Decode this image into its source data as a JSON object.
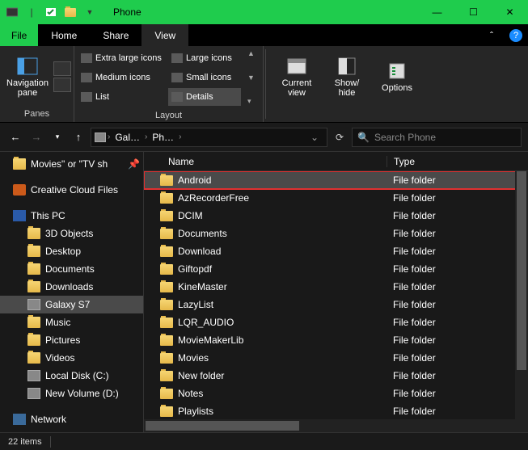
{
  "title": "Phone",
  "menu": {
    "file": "File",
    "tabs": [
      "Home",
      "Share",
      "View"
    ],
    "active": 2
  },
  "ribbon": {
    "panes": {
      "nav_label": "Navigation\npane",
      "group": "Panes"
    },
    "layout": {
      "items": [
        "Extra large icons",
        "Large icons",
        "Medium icons",
        "Small icons",
        "List",
        "Details"
      ],
      "selected": "Details",
      "group": "Layout"
    },
    "current_view": "Current\nview",
    "show_hide": "Show/\nhide",
    "options": "Options"
  },
  "addr": {
    "crumbs": [
      "Gal…",
      "Ph…"
    ],
    "search_placeholder": "Search Phone"
  },
  "tree": [
    {
      "label": "Movies\" or \"TV sh",
      "icon": "folder",
      "pin": true
    },
    {
      "spacer": true
    },
    {
      "label": "Creative Cloud Files",
      "icon": "cloud"
    },
    {
      "spacer": true
    },
    {
      "label": "This PC",
      "icon": "pc"
    },
    {
      "label": "3D Objects",
      "icon": "folder",
      "lvl": 2
    },
    {
      "label": "Desktop",
      "icon": "folder",
      "lvl": 2
    },
    {
      "label": "Documents",
      "icon": "folder",
      "lvl": 2
    },
    {
      "label": "Downloads",
      "icon": "folder",
      "lvl": 2
    },
    {
      "label": "Galaxy S7",
      "icon": "drive",
      "lvl": 2,
      "sel": true
    },
    {
      "label": "Music",
      "icon": "folder",
      "lvl": 2
    },
    {
      "label": "Pictures",
      "icon": "folder",
      "lvl": 2
    },
    {
      "label": "Videos",
      "icon": "folder",
      "lvl": 2
    },
    {
      "label": "Local Disk (C:)",
      "icon": "drive",
      "lvl": 2
    },
    {
      "label": "New Volume (D:)",
      "icon": "drive",
      "lvl": 2
    },
    {
      "spacer": true
    },
    {
      "label": "Network",
      "icon": "net"
    }
  ],
  "columns": {
    "name": "Name",
    "type": "Type"
  },
  "rows": [
    {
      "name": "Android",
      "type": "File folder",
      "hl": true
    },
    {
      "name": "AzRecorderFree",
      "type": "File folder"
    },
    {
      "name": "DCIM",
      "type": "File folder"
    },
    {
      "name": "Documents",
      "type": "File folder"
    },
    {
      "name": "Download",
      "type": "File folder"
    },
    {
      "name": "Giftopdf",
      "type": "File folder"
    },
    {
      "name": "KineMaster",
      "type": "File folder"
    },
    {
      "name": "LazyList",
      "type": "File folder"
    },
    {
      "name": "LQR_AUDIO",
      "type": "File folder"
    },
    {
      "name": "MovieMakerLib",
      "type": "File folder"
    },
    {
      "name": "Movies",
      "type": "File folder"
    },
    {
      "name": "New folder",
      "type": "File folder"
    },
    {
      "name": "Notes",
      "type": "File folder"
    },
    {
      "name": "Playlists",
      "type": "File folder"
    }
  ],
  "status": {
    "count": "22 items"
  }
}
